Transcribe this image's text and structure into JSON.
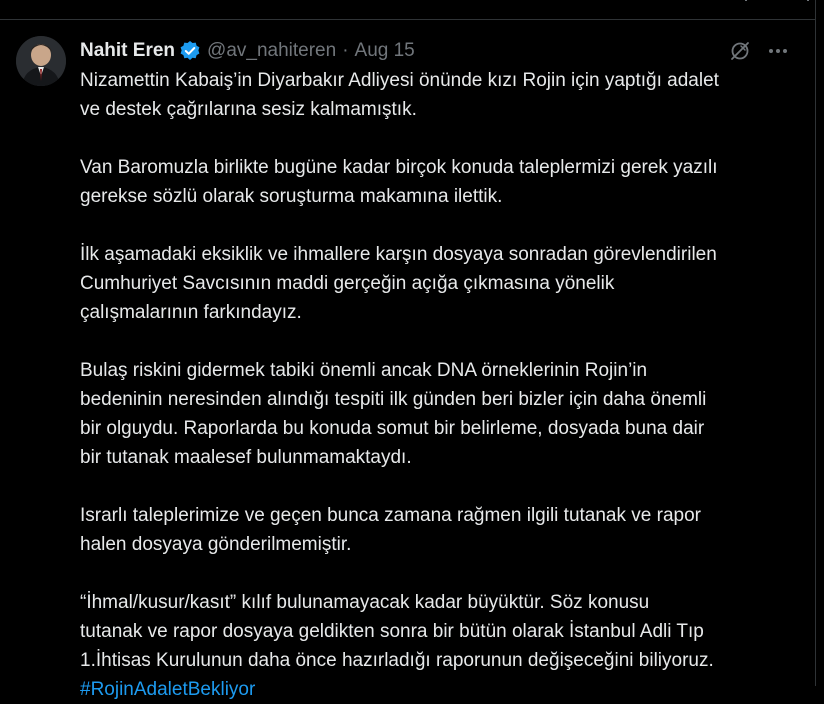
{
  "tweet": {
    "author": {
      "display_name": "Nahit Eren",
      "verified": true,
      "verified_icon": "verified-badge-icon",
      "handle": "@av_nahiteren",
      "separator": "·",
      "date": "Aug 15"
    },
    "paragraphs": [
      "Nizamettin Kabaiş’in Diyarbakır Adliyesi önünde kızı Rojin için yaptığı adalet\nve destek çağrılarına sesiz kalmamıştık.",
      "Van Baromuzla birlikte bugüne kadar birçok konuda taleplermizi gerek yazılı\ngerekse sözlü olarak soruşturma makamına ilettik.",
      "İlk aşamadaki eksiklik ve ihmallere karşın dosyaya sonradan görevlendirilen\nCumhuriyet Savcısının maddi gerçeğin açığa çıkmasına yönelik\nçalışmalarının farkındayız.",
      "Bulaş riskini gidermek tabiki önemli ancak DNA örneklerinin Rojin’in\nbedeninin neresinden alındığı tespiti ilk günden beri bizler için daha önemli\nbir olguydu. Raporlarda bu konuda somut bir belirleme, dosyada buna dair\nbir tutanak maalesef bulunmamaktaydı.",
      "Israrlı taleplerimize ve geçen bunca zamana rağmen ilgili tutanak ve rapor\nhalen dosyaya gönderilmemiştir.",
      "“İhmal/kusur/kasıt” kılıf bulunamayacak kadar büyüktür. Söz konusu\ntutanak ve rapor dosyaya geldikten sonra bir bütün olarak İstanbul Adli Tıp\n1.İhtisas Kurulunun daha önce hazırladığı raporunun değişeceğini biliyoruz."
    ],
    "hashtag": "#RojinAdaletBekliyor",
    "icons": {
      "grok": "grok-icon",
      "more": "more-icon"
    }
  },
  "colors": {
    "background": "#000000",
    "text": "#e7e9ea",
    "muted": "#71767b",
    "accent": "#1d9bf0",
    "border": "#2f3336"
  }
}
